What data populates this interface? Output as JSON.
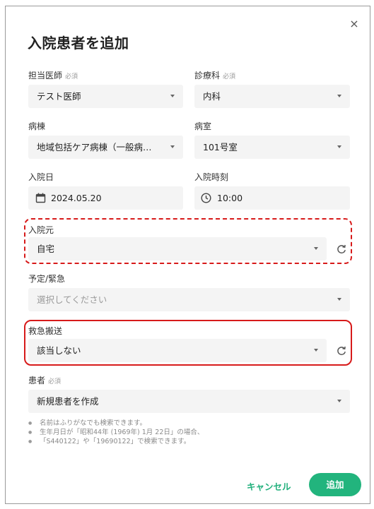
{
  "dialog": {
    "title": "入院患者を追加",
    "close_icon": "×"
  },
  "doctor": {
    "label": "担当医師",
    "required": "必須",
    "value": "テスト医師"
  },
  "department": {
    "label": "診療科",
    "required": "必須",
    "value": "内科"
  },
  "ward": {
    "label": "病棟",
    "value": "地域包括ケア病棟（一般病…"
  },
  "room": {
    "label": "病室",
    "value": "101号室"
  },
  "admission_date": {
    "label": "入院日",
    "value": "2024.05.20"
  },
  "admission_time": {
    "label": "入院時刻",
    "value": "10:00"
  },
  "admission_source": {
    "label": "入院元",
    "value": "自宅"
  },
  "planned_emergency": {
    "label": "予定/緊急",
    "placeholder": "選択してください"
  },
  "emergency_transport": {
    "label": "救急搬送",
    "value": "該当しない"
  },
  "patient": {
    "label": "患者",
    "required": "必須",
    "value": "新規患者を作成"
  },
  "notes": [
    "名前はふりがなでも検索できます。",
    "生年月日が「昭和44年 (1969年) 1月 22日」の場合、",
    "「S440122」や「19690122」で検索できます。"
  ],
  "buttons": {
    "cancel": "キャンセル",
    "add": "追加"
  },
  "colors": {
    "accent": "#22b47d",
    "highlight": "#d71a1a"
  }
}
